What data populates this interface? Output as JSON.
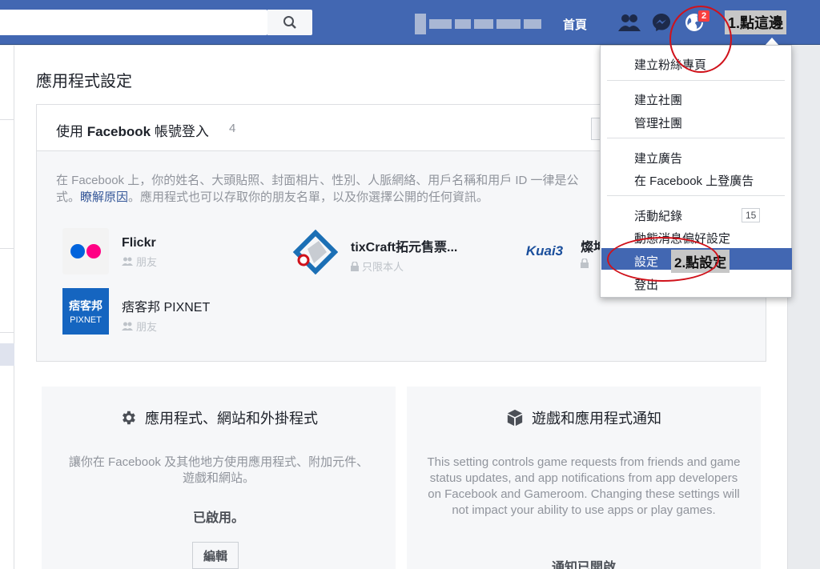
{
  "topbar": {
    "home_label": "首頁",
    "notif_count": "2",
    "annotation_1": "1.點這邊"
  },
  "main": {
    "page_title": "應用程式設定",
    "fb_login": {
      "title_prefix": "使用 ",
      "title_bold": "Facebook",
      "title_suffix": " 帳號登入",
      "count": "4",
      "desc_part1": "在 Facebook 上，你的姓名、大頭貼照、封面相片、性別、人脈網絡、用戶名稱和用戶 ID 一律是公",
      "desc_part2": "式。",
      "desc_link": "瞭解原因",
      "desc_part3": "。應用程式也可以存取你的朋友名單，以及你選擇公開的任何資訊。",
      "apps": [
        {
          "name": "Flickr",
          "audience": "朋友"
        },
        {
          "name": "tixCraft拓元售票...",
          "audience": "只限本人"
        },
        {
          "name": "燦坤",
          "audience": ""
        },
        {
          "name": "痞客邦 PIXNET",
          "audience": "朋友"
        }
      ],
      "pixnet_logo_top": "痞客邦",
      "pixnet_logo_bottom": "PIXNET",
      "kuai_logo": "Kuai3"
    },
    "card_apps": {
      "title": "應用程式、網站和外掛程式",
      "desc": "讓你在 Facebook 及其他地方使用應用程式、附加元件、遊戲和網站。",
      "status": "已啟用。",
      "edit_label": "編輯"
    },
    "card_games": {
      "title": "遊戲和應用程式通知",
      "desc": "This setting controls game requests from friends and game status updates, and app notifications from app developers on Facebook and Gameroom. Changing these settings will not impact your ability to use apps or play games.",
      "status": "通知已開啟"
    }
  },
  "dropdown": {
    "items": [
      "建立粉絲專頁",
      "建立社團",
      "管理社團",
      "建立廣告",
      "在 Facebook 上登廣告",
      "活動紀錄",
      "動態消息偏好設定",
      "設定",
      "登出"
    ],
    "activity_count": "15",
    "annotation_2": "2.點設定"
  },
  "colors": {
    "brand": "#4267b2",
    "annotation_circle": "#d0121b"
  }
}
